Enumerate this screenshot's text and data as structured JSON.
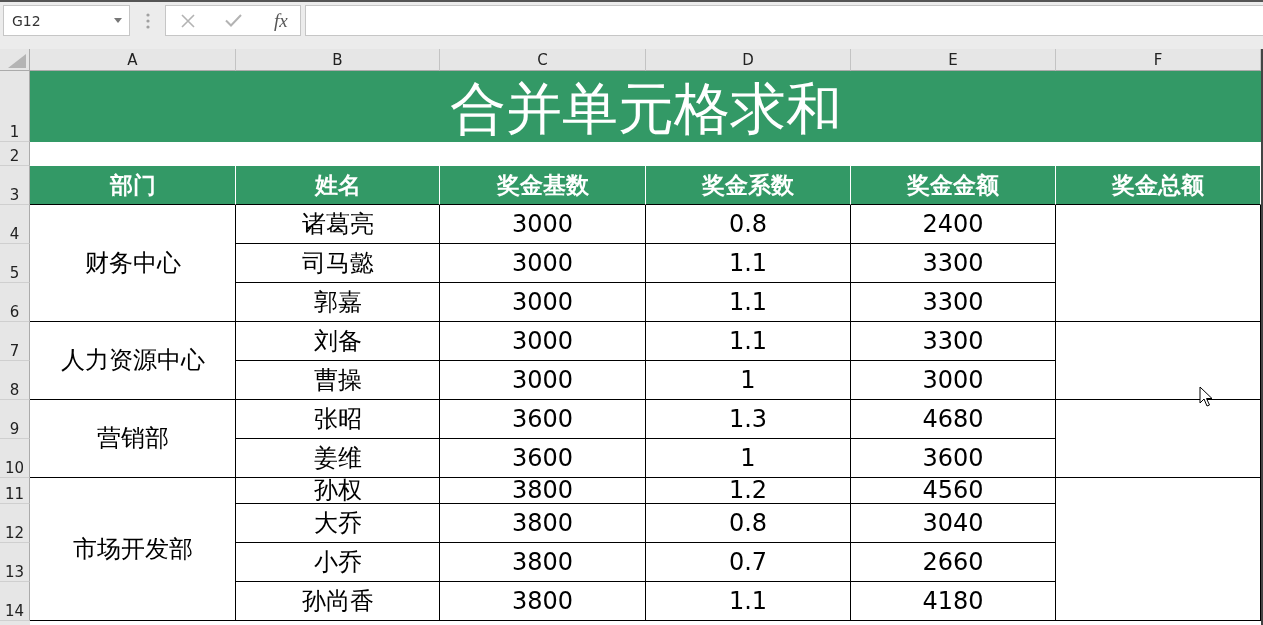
{
  "name_box": {
    "value": "G12"
  },
  "formula_bar": {
    "buttons": [
      {
        "kind": "cancel",
        "disabled": true
      },
      {
        "kind": "enter",
        "disabled": true
      },
      {
        "kind": "function",
        "label": "fx",
        "disabled": false
      }
    ]
  },
  "sheet": {
    "column_headers": [
      "A",
      "B",
      "C",
      "D",
      "E",
      "F"
    ],
    "row_headers": [
      "1",
      "2",
      "3",
      "4",
      "5",
      "6",
      "7",
      "8",
      "9",
      "10",
      "11",
      "12",
      "13",
      "14"
    ],
    "title": "合并单元格求和",
    "table": {
      "columns": [
        "部门",
        "姓名",
        "奖金基数",
        "奖金系数",
        "奖金金额",
        "奖金总额"
      ],
      "groups": [
        {
          "department": "财务中心",
          "rows": [
            {
              "name": "诸葛亮",
              "base": "3000",
              "factor": "0.8",
              "amount": "2400"
            },
            {
              "name": "司马懿",
              "base": "3000",
              "factor": "1.1",
              "amount": "3300"
            },
            {
              "name": "郭嘉",
              "base": "3000",
              "factor": "1.1",
              "amount": "3300"
            }
          ]
        },
        {
          "department": "人力资源中心",
          "rows": [
            {
              "name": "刘备",
              "base": "3000",
              "factor": "1.1",
              "amount": "3300"
            },
            {
              "name": "曹操",
              "base": "3000",
              "factor": "1",
              "amount": "3000"
            }
          ]
        },
        {
          "department": "营销部",
          "rows": [
            {
              "name": "张昭",
              "base": "3600",
              "factor": "1.3",
              "amount": "4680"
            },
            {
              "name": "姜维",
              "base": "3600",
              "factor": "1",
              "amount": "3600"
            }
          ]
        },
        {
          "department": "市场开发部",
          "rows": [
            {
              "name": "孙权",
              "base": "3800",
              "factor": "1.2",
              "amount": "4560"
            },
            {
              "name": "大乔",
              "base": "3800",
              "factor": "0.8",
              "amount": "3040"
            },
            {
              "name": "小乔",
              "base": "3800",
              "factor": "0.7",
              "amount": "2660"
            },
            {
              "name": "孙尚香",
              "base": "3800",
              "factor": "1.1",
              "amount": "4180"
            }
          ]
        }
      ]
    }
  }
}
